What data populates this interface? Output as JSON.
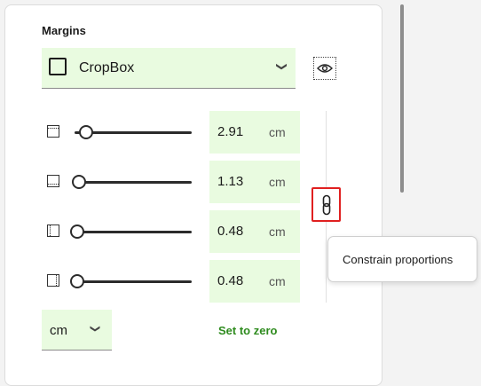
{
  "margins": {
    "title": "Margins",
    "box_select": {
      "value": "CropBox"
    },
    "rows": [
      {
        "side": "top",
        "value": "2.91",
        "unit": "cm"
      },
      {
        "side": "bottom",
        "value": "1.13",
        "unit": "cm"
      },
      {
        "side": "left",
        "value": "0.48",
        "unit": "cm"
      },
      {
        "side": "right",
        "value": "0.48",
        "unit": "cm"
      }
    ],
    "unit_select": {
      "value": "cm"
    },
    "set_zero_label": "Set to zero",
    "tooltip": "Constrain proportions"
  },
  "colors": {
    "accent": "#2e8b1e",
    "field_bg": "#e9fbe0",
    "highlight": "#e02020"
  }
}
